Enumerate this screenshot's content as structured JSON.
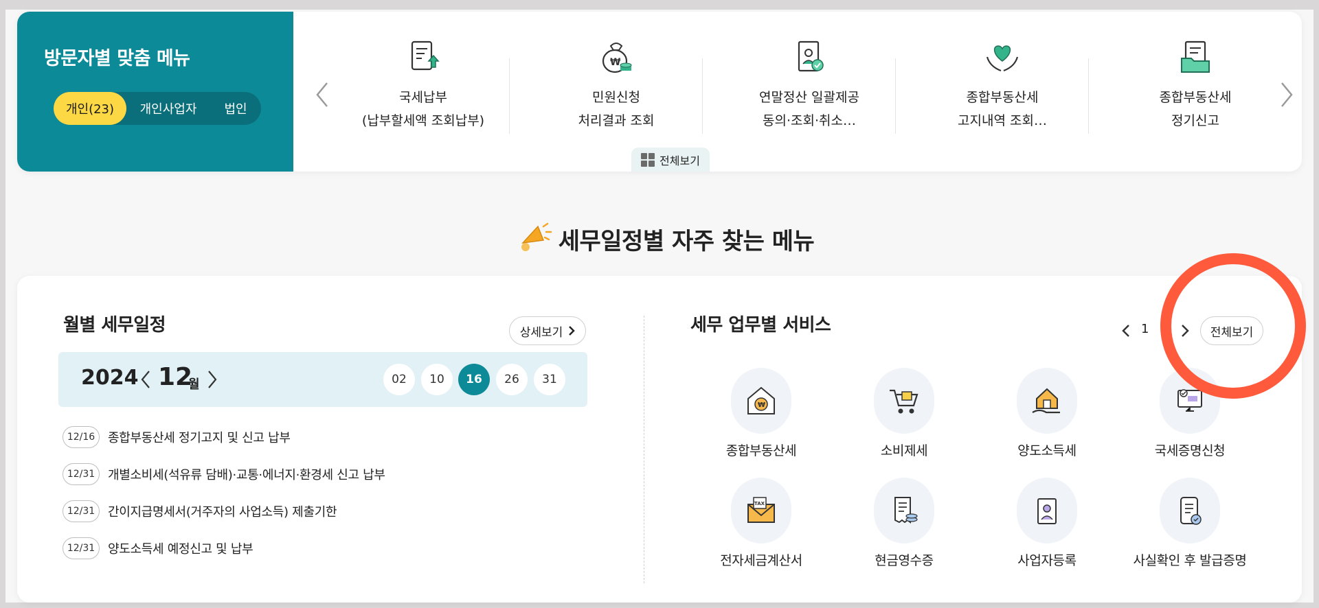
{
  "visitor_menu": {
    "title": "방문자별 맞춤 메뉴",
    "tabs": [
      {
        "label": "개인(23)",
        "active": true
      },
      {
        "label": "개인사업자",
        "active": false
      },
      {
        "label": "법인",
        "active": false
      }
    ]
  },
  "quick_menu": {
    "items": [
      {
        "line1": "국세납부",
        "line2": "(납부할세액 조회납부)",
        "icon": "tax-payment-icon"
      },
      {
        "line1": "민원신청",
        "line2": "처리결과 조회",
        "icon": "money-bag-icon"
      },
      {
        "line1": "연말정산 일괄제공",
        "line2": "동의·조회·취소…",
        "icon": "certificate-icon"
      },
      {
        "line1": "종합부동산세",
        "line2": "고지내역 조회…",
        "icon": "heart-hands-icon"
      },
      {
        "line1": "종합부동산세",
        "line2": "정기신고",
        "icon": "document-folder-icon"
      }
    ],
    "view_all_label": "전체보기"
  },
  "section_heading": "세무일정별 자주 찾는 메뉴",
  "schedule": {
    "title": "월별 세무일정",
    "detail_button": "상세보기",
    "year": "2024",
    "month": "12",
    "month_unit": "월",
    "days": [
      {
        "label": "02",
        "active": false
      },
      {
        "label": "10",
        "active": false
      },
      {
        "label": "16",
        "active": true
      },
      {
        "label": "26",
        "active": false
      },
      {
        "label": "31",
        "active": false
      }
    ],
    "items": [
      {
        "date": "12/16",
        "text": "종합부동산세 정기고지 및 신고 납부"
      },
      {
        "date": "12/31",
        "text": "개별소비세(석유류 담배)·교통·에너지·환경세 신고 납부"
      },
      {
        "date": "12/31",
        "text": "간이지급명세서(거주자의 사업소득) 제출기한"
      },
      {
        "date": "12/31",
        "text": "양도소득세 예정신고 및 납부"
      }
    ]
  },
  "services": {
    "title": "세무 업무별 서비스",
    "page": "1",
    "view_all_label": "전체보기",
    "items": [
      {
        "label": "종합부동산세",
        "icon": "house-coin-icon"
      },
      {
        "label": "소비제세",
        "icon": "shopping-cart-icon"
      },
      {
        "label": "양도소득세",
        "icon": "house-hand-icon"
      },
      {
        "label": "국세증명신청",
        "icon": "certificate-monitor-icon"
      },
      {
        "label": "전자세금계산서",
        "icon": "tax-envelope-icon"
      },
      {
        "label": "현금영수증",
        "icon": "receipt-coins-icon"
      },
      {
        "label": "사업자등록",
        "icon": "registration-id-icon"
      },
      {
        "label": "사실확인 후 발급증명",
        "icon": "mobile-verify-icon"
      }
    ]
  },
  "colors": {
    "brand_teal": "#0d8a97",
    "accent_yellow": "#fcd844",
    "highlight_red": "#ff5a3c"
  }
}
